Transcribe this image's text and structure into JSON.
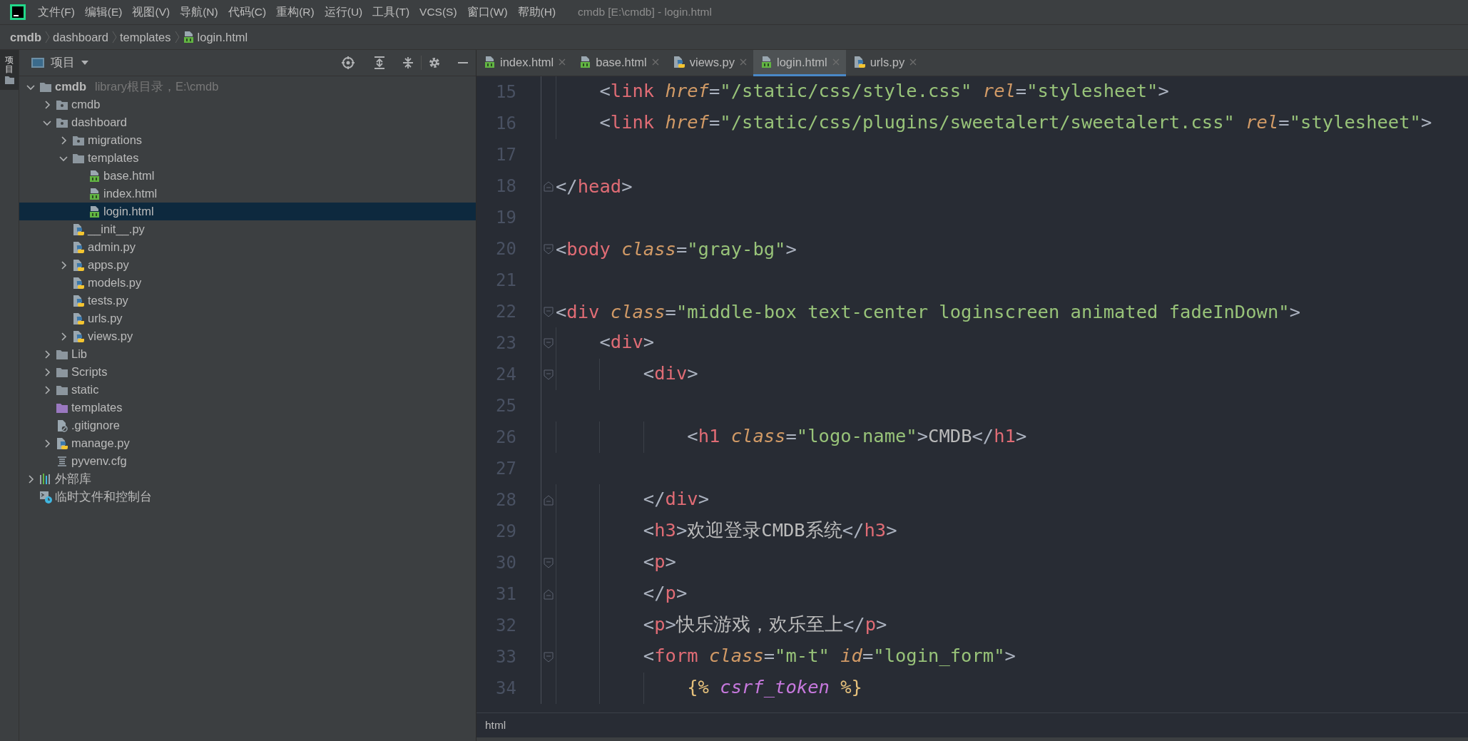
{
  "menu_bar": {
    "items": [
      "文件(F)",
      "编辑(E)",
      "视图(V)",
      "导航(N)",
      "代码(C)",
      "重构(R)",
      "运行(U)",
      "工具(T)",
      "VCS(S)",
      "窗口(W)",
      "帮助(H)"
    ],
    "window_title": "cmdb [E:\\cmdb] - login.html"
  },
  "breadcrumb": [
    {
      "label": "cmdb",
      "kind": "project"
    },
    {
      "label": "dashboard",
      "kind": "folder"
    },
    {
      "label": "templates",
      "kind": "folder"
    },
    {
      "label": "login.html",
      "kind": "html"
    }
  ],
  "side_strip": {
    "label": "项目"
  },
  "project_panel": {
    "title": "项目",
    "tree": [
      {
        "name": "cmdb",
        "kind": "folder",
        "hint": "library根目录，E:\\cmdb",
        "expanded": true,
        "selected": false,
        "children": [
          {
            "name": "cmdb",
            "kind": "package",
            "expanded": false,
            "selected": false
          },
          {
            "name": "dashboard",
            "kind": "package",
            "expanded": true,
            "selected": false,
            "children": [
              {
                "name": "migrations",
                "kind": "package",
                "expanded": false,
                "selected": false
              },
              {
                "name": "templates",
                "kind": "folder",
                "expanded": true,
                "selected": false,
                "children": [
                  {
                    "name": "base.html",
                    "kind": "html",
                    "selected": false
                  },
                  {
                    "name": "index.html",
                    "kind": "html",
                    "selected": false
                  },
                  {
                    "name": "login.html",
                    "kind": "html",
                    "selected": true
                  }
                ]
              },
              {
                "name": "__init__.py",
                "kind": "python",
                "selected": false
              },
              {
                "name": "admin.py",
                "kind": "python",
                "selected": false
              },
              {
                "name": "apps.py",
                "kind": "python",
                "expanded": false,
                "selected": false
              },
              {
                "name": "models.py",
                "kind": "python",
                "selected": false
              },
              {
                "name": "tests.py",
                "kind": "python",
                "selected": false
              },
              {
                "name": "urls.py",
                "kind": "python",
                "selected": false
              },
              {
                "name": "views.py",
                "kind": "python",
                "expanded": false,
                "selected": false
              }
            ]
          },
          {
            "name": "Lib",
            "kind": "folder",
            "expanded": false,
            "selected": false
          },
          {
            "name": "Scripts",
            "kind": "folder",
            "expanded": false,
            "selected": false
          },
          {
            "name": "static",
            "kind": "folder",
            "expanded": false,
            "selected": false
          },
          {
            "name": "templates",
            "kind": "template-folder",
            "selected": false
          },
          {
            "name": ".gitignore",
            "kind": "ignore",
            "selected": false
          },
          {
            "name": "manage.py",
            "kind": "python",
            "expanded": false,
            "selected": false
          },
          {
            "name": "pyvenv.cfg",
            "kind": "config",
            "selected": false
          }
        ]
      },
      {
        "name": "外部库",
        "kind": "library",
        "expanded": false,
        "selected": false
      },
      {
        "name": "临时文件和控制台",
        "kind": "scratch",
        "selected": false
      }
    ]
  },
  "tabs": [
    {
      "label": "index.html",
      "kind": "html",
      "selected": false
    },
    {
      "label": "base.html",
      "kind": "html",
      "selected": false
    },
    {
      "label": "views.py",
      "kind": "python",
      "selected": false
    },
    {
      "label": "login.html",
      "kind": "html",
      "selected": true
    },
    {
      "label": "urls.py",
      "kind": "python",
      "selected": false
    }
  ],
  "editor": {
    "lines": [
      {
        "number": "15",
        "tokens": [
          {
            "kind": "punct",
            "text": "    <"
          },
          {
            "kind": "tag",
            "text": "link"
          },
          {
            "kind": "attr",
            "text": " href"
          },
          {
            "kind": "punct",
            "text": "="
          },
          {
            "kind": "string",
            "text": "\"/static/css/style.css\""
          },
          {
            "kind": "attr",
            "text": " rel"
          },
          {
            "kind": "punct",
            "text": "="
          },
          {
            "kind": "string",
            "text": "\"stylesheet\""
          },
          {
            "kind": "punct",
            "text": ">"
          }
        ]
      },
      {
        "number": "16",
        "tokens": [
          {
            "kind": "punct",
            "text": "    <"
          },
          {
            "kind": "tag",
            "text": "link"
          },
          {
            "kind": "attr",
            "text": " href"
          },
          {
            "kind": "punct",
            "text": "="
          },
          {
            "kind": "string",
            "text": "\"/static/css/plugins/sweetalert/sweetalert.css\""
          },
          {
            "kind": "attr",
            "text": " rel"
          },
          {
            "kind": "punct",
            "text": "="
          },
          {
            "kind": "string",
            "text": "\"stylesheet\""
          },
          {
            "kind": "punct",
            "text": ">"
          }
        ]
      },
      {
        "number": "17"
      },
      {
        "number": "18",
        "fold_end": true,
        "tokens": [
          {
            "kind": "punct",
            "text": "</"
          },
          {
            "kind": "tag",
            "text": "head"
          },
          {
            "kind": "punct",
            "text": ">"
          }
        ]
      },
      {
        "number": "19"
      },
      {
        "number": "20",
        "fold_start": true,
        "tokens": [
          {
            "kind": "punct",
            "text": "<"
          },
          {
            "kind": "tag",
            "text": "body"
          },
          {
            "kind": "attr",
            "text": " class"
          },
          {
            "kind": "punct",
            "text": "="
          },
          {
            "kind": "string",
            "text": "\"gray-bg\""
          },
          {
            "kind": "punct",
            "text": ">"
          }
        ]
      },
      {
        "number": "21"
      },
      {
        "number": "22",
        "fold_start": true,
        "tokens": [
          {
            "kind": "punct",
            "text": "<"
          },
          {
            "kind": "tag",
            "text": "div"
          },
          {
            "kind": "attr",
            "text": " class"
          },
          {
            "kind": "punct",
            "text": "="
          },
          {
            "kind": "string",
            "text": "\"middle-box text-center loginscreen animated fadeInDown\""
          },
          {
            "kind": "punct",
            "text": ">"
          }
        ]
      },
      {
        "number": "23",
        "fold_start": true,
        "tokens": [
          {
            "kind": "punct",
            "text": "    <"
          },
          {
            "kind": "tag",
            "text": "div"
          },
          {
            "kind": "punct",
            "text": ">"
          }
        ]
      },
      {
        "number": "24",
        "fold_start": true,
        "tokens": [
          {
            "kind": "punct",
            "text": "        <"
          },
          {
            "kind": "tag",
            "text": "div"
          },
          {
            "kind": "punct",
            "text": ">"
          }
        ]
      },
      {
        "number": "25"
      },
      {
        "number": "26",
        "tokens": [
          {
            "kind": "punct",
            "text": "            <"
          },
          {
            "kind": "tag",
            "text": "h1"
          },
          {
            "kind": "attr",
            "text": " class"
          },
          {
            "kind": "punct",
            "text": "="
          },
          {
            "kind": "string",
            "text": "\"logo-name\""
          },
          {
            "kind": "punct",
            "text": ">"
          },
          {
            "kind": "text",
            "text": "CMDB"
          },
          {
            "kind": "punct",
            "text": "</"
          },
          {
            "kind": "tag",
            "text": "h1"
          },
          {
            "kind": "punct",
            "text": ">"
          }
        ]
      },
      {
        "number": "27"
      },
      {
        "number": "28",
        "fold_end": true,
        "tokens": [
          {
            "kind": "punct",
            "text": "        </"
          },
          {
            "kind": "tag",
            "text": "div"
          },
          {
            "kind": "punct",
            "text": ">"
          }
        ]
      },
      {
        "number": "29",
        "tokens": [
          {
            "kind": "punct",
            "text": "        <"
          },
          {
            "kind": "tag",
            "text": "h3"
          },
          {
            "kind": "punct",
            "text": ">"
          },
          {
            "kind": "text",
            "text": "欢迎登录CMDB系统"
          },
          {
            "kind": "punct",
            "text": "</"
          },
          {
            "kind": "tag",
            "text": "h3"
          },
          {
            "kind": "punct",
            "text": ">"
          }
        ]
      },
      {
        "number": "30",
        "fold_start": true,
        "tokens": [
          {
            "kind": "punct",
            "text": "        <"
          },
          {
            "kind": "tag",
            "text": "p"
          },
          {
            "kind": "punct",
            "text": ">"
          }
        ]
      },
      {
        "number": "31",
        "fold_end": true,
        "tokens": [
          {
            "kind": "punct",
            "text": "        </"
          },
          {
            "kind": "tag",
            "text": "p"
          },
          {
            "kind": "punct",
            "text": ">"
          }
        ]
      },
      {
        "number": "32",
        "tokens": [
          {
            "kind": "punct",
            "text": "        <"
          },
          {
            "kind": "tag",
            "text": "p"
          },
          {
            "kind": "punct",
            "text": ">"
          },
          {
            "kind": "text",
            "text": "快乐游戏，欢乐至上"
          },
          {
            "kind": "punct",
            "text": "</"
          },
          {
            "kind": "tag",
            "text": "p"
          },
          {
            "kind": "punct",
            "text": ">"
          }
        ]
      },
      {
        "number": "33",
        "fold_start": true,
        "tokens": [
          {
            "kind": "punct",
            "text": "        <"
          },
          {
            "kind": "tag",
            "text": "form"
          },
          {
            "kind": "attr",
            "text": " class"
          },
          {
            "kind": "punct",
            "text": "="
          },
          {
            "kind": "string",
            "text": "\"m-t\""
          },
          {
            "kind": "attr",
            "text": " id"
          },
          {
            "kind": "punct",
            "text": "="
          },
          {
            "kind": "string",
            "text": "\"login_form\""
          },
          {
            "kind": "punct",
            "text": ">"
          }
        ]
      },
      {
        "number": "34",
        "tokens": [
          {
            "kind": "template",
            "text": "            {%"
          },
          {
            "kind": "template-name",
            "text": " csrf_token"
          },
          {
            "kind": "template",
            "text": " %}"
          }
        ]
      }
    ],
    "status": "html"
  }
}
